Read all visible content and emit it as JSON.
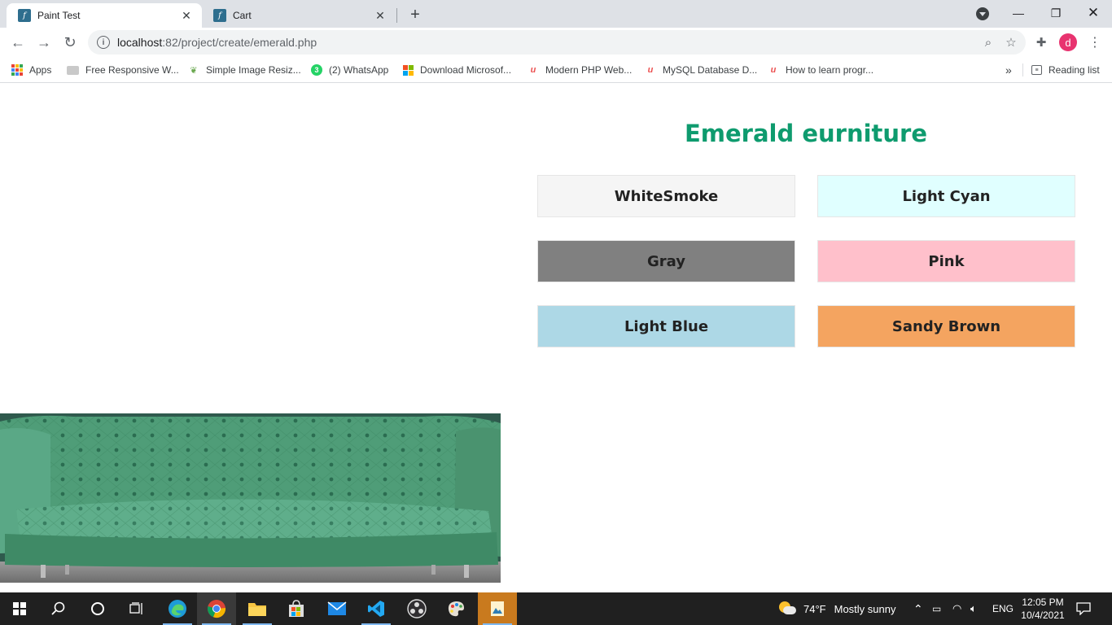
{
  "browser": {
    "tabs": [
      {
        "title": "Paint Test",
        "active": true
      },
      {
        "title": "Cart",
        "active": false
      }
    ],
    "new_tab_label": "+",
    "url_host": "localhost",
    "url_path": ":82/project/create/emerald.php",
    "bookmarks": [
      {
        "label": "Apps",
        "icon": "apps-grid-icon"
      },
      {
        "label": "Free Responsive W...",
        "icon": "site-icon"
      },
      {
        "label": "Simple Image Resiz...",
        "icon": "leaf-icon"
      },
      {
        "label": "(2) WhatsApp",
        "icon": "whatsapp-icon",
        "badge": "3"
      },
      {
        "label": "Download Microsof...",
        "icon": "microsoft-icon"
      },
      {
        "label": "Modern PHP Web...",
        "icon": "udemy-icon"
      },
      {
        "label": "MySQL Database D...",
        "icon": "udemy-icon"
      },
      {
        "label": "How to learn progr...",
        "icon": "udemy-icon"
      }
    ],
    "more_bookmarks": "»",
    "reading_list": "Reading list",
    "avatar_letter": "d"
  },
  "page": {
    "heading": "Emerald eurniture",
    "colors": [
      {
        "label": "WhiteSmoke",
        "bg": "#f5f5f5"
      },
      {
        "label": "Light Cyan",
        "bg": "#e0ffff"
      },
      {
        "label": "Gray",
        "bg": "#808080"
      },
      {
        "label": "Pink",
        "bg": "#ffc0cb"
      },
      {
        "label": "Light Blue",
        "bg": "#add8e6"
      },
      {
        "label": "Sandy Brown",
        "bg": "#f4a460"
      }
    ],
    "sofa_color": "#4f9d78",
    "accent": "#0e9b6e"
  },
  "taskbar": {
    "weather_temp": "74°F",
    "weather_text": "Mostly sunny",
    "language": "ENG",
    "time": "12:05 PM",
    "date": "10/4/2021"
  }
}
